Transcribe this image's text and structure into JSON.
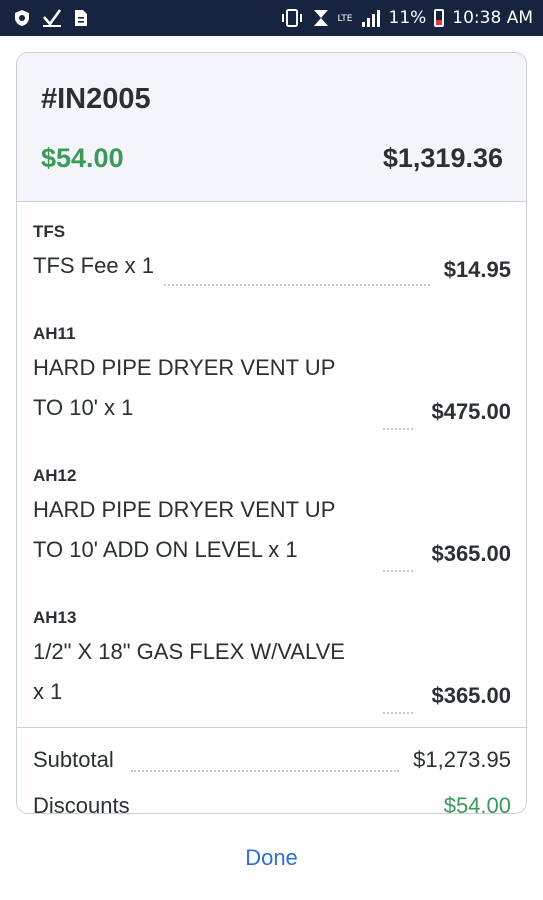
{
  "status_bar": {
    "battery": "11%",
    "time": "10:38 AM",
    "network": "LTE",
    "icons": [
      "shield-icon",
      "check-icon",
      "document-icon",
      "vibrate-icon",
      "alarm-icon",
      "lte-icon",
      "signal-icon",
      "battery-icon"
    ],
    "battery_level": 0.11
  },
  "invoice": {
    "number": "#IN2005",
    "paid_amount": "$54.00",
    "total_amount": "$1,319.36"
  },
  "line_items": [
    {
      "code": "TFS",
      "description": [
        "TFS Fee x 1"
      ],
      "price": "$14.95"
    },
    {
      "code": "AH11",
      "description": [
        "HARD PIPE DRYER VENT UP",
        "TO 10' x 1"
      ],
      "price": "$475.00"
    },
    {
      "code": "AH12",
      "description": [
        "HARD PIPE DRYER VENT UP",
        "TO 10' ADD ON LEVEL x 1"
      ],
      "price": "$365.00"
    },
    {
      "code": "AH13",
      "description": [
        "1/2\" X 18\" GAS FLEX W/VALVE",
        "x 1"
      ],
      "price": "$365.00"
    }
  ],
  "totals": {
    "subtotal_label": "Subtotal",
    "subtotal_value": "$1,273.95",
    "discounts_label": "Discounts",
    "discounts_value": "$54.00"
  },
  "actions": {
    "done_label": "Done"
  },
  "colors": {
    "status_bar_bg": "#16243f",
    "paid_green": "#3b9a5a",
    "link_blue": "#2e6fd3",
    "header_bg": "#f3f5f8"
  }
}
